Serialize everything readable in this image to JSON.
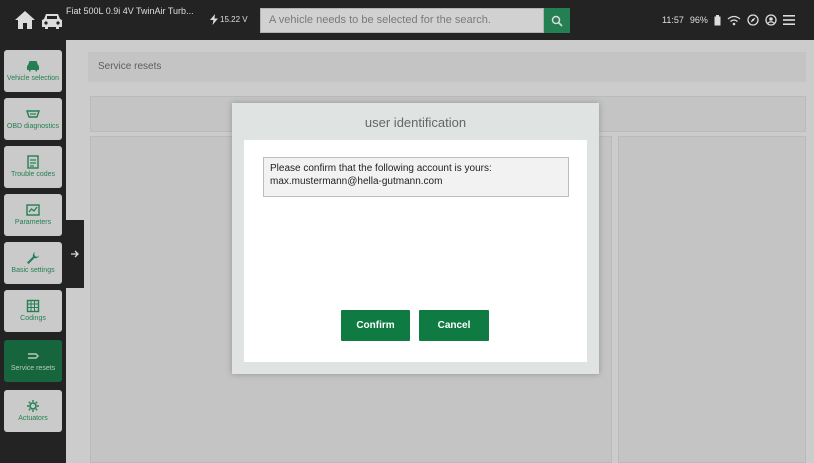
{
  "topbar": {
    "vehicle_name": "Fiat 500L 0.9i 4V TwinAir Turb...",
    "voltage": "15.22 V",
    "search_placeholder": "A vehicle needs to be selected for the search.",
    "time": "11:57",
    "battery": "96%"
  },
  "sidebar": {
    "items": [
      {
        "label": "Vehicle selection",
        "icon": "car-icon"
      },
      {
        "label": "OBD diagnostics",
        "icon": "obd-icon"
      },
      {
        "label": "Trouble codes",
        "icon": "trouble-codes-icon"
      },
      {
        "label": "Parameters",
        "icon": "parameters-icon"
      },
      {
        "label": "Basic settings",
        "icon": "wrench-icon"
      },
      {
        "label": "Codings",
        "icon": "codings-icon"
      },
      {
        "label": "Service resets",
        "icon": "service-reset-icon"
      },
      {
        "label": "Actuators",
        "icon": "actuators-icon"
      }
    ]
  },
  "main": {
    "page_title": "Service resets"
  },
  "dialog": {
    "title": "user identification",
    "message_line1": "Please confirm that the following account is yours:",
    "message_line2": "max.mustermann@hella-gutmann.com",
    "confirm_label": "Confirm",
    "cancel_label": "Cancel"
  },
  "colors": {
    "accent": "#0f7a42",
    "topbar_bg": "#1e1e1e",
    "active_item": "#0f6e3c"
  }
}
